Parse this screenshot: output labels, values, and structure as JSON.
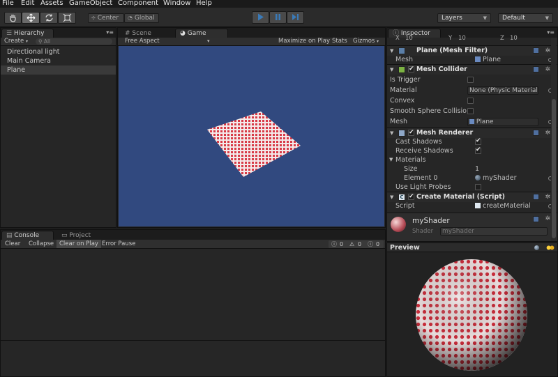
{
  "menu": [
    "File",
    "Edit",
    "Assets",
    "GameObject",
    "Component",
    "Window",
    "Help"
  ],
  "toolbar": {
    "pivot_label": "Center",
    "space_label": "Global",
    "layers_label": "Layers",
    "layout_label": "Default",
    "accent": "#3a7ab8"
  },
  "hierarchy": {
    "tab": "Hierarchy",
    "create_label": "Create",
    "search_placeholder": "All",
    "items": [
      {
        "label": "Directional light"
      },
      {
        "label": "Main Camera"
      },
      {
        "label": "Plane",
        "selected": true
      }
    ]
  },
  "scene": {
    "scene_tab": "Scene",
    "game_tab": "Game",
    "aspect_label": "Free Aspect",
    "maximize_label": "Maximize on Play",
    "stats_label": "Stats",
    "gizmos_label": "Gizmos",
    "background": "#31497f"
  },
  "console": {
    "console_tab": "Console",
    "project_tab": "Project",
    "buttons": [
      "Clear",
      "Collapse",
      "Clear on Play",
      "Error Pause"
    ],
    "counts": [
      "0",
      "0",
      "0"
    ]
  },
  "inspector": {
    "tab": "Inspector",
    "transform_row": [
      "X",
      "10",
      "Y",
      "10",
      "Z",
      "10"
    ],
    "mesh_filter": {
      "title": "Plane (Mesh Filter)",
      "mesh_label": "Mesh",
      "mesh_value": "Plane"
    },
    "mesh_collider": {
      "title": "Mesh Collider",
      "rows": [
        {
          "label": "Is Trigger",
          "value": ""
        },
        {
          "label": "Material",
          "value": "None (Physic Material"
        },
        {
          "label": "Convex",
          "value": ""
        },
        {
          "label": "Smooth Sphere Collisio",
          "value": ""
        },
        {
          "label": "Mesh",
          "value": "Plane"
        }
      ]
    },
    "mesh_renderer": {
      "title": "Mesh Renderer",
      "cast_shadows_label": "Cast Shadows",
      "receive_shadows_label": "Receive Shadows",
      "materials_label": "Materials",
      "size_label": "Size",
      "size_value": "1",
      "element_label": "Element 0",
      "element_value": "myShader",
      "light_probes_label": "Use Light Probes"
    },
    "script": {
      "title": "Create Material (Script)",
      "script_label": "Script",
      "script_value": "createMaterial"
    },
    "material": {
      "name": "myShader",
      "shader_label": "Shader",
      "shader_value": "myShader"
    },
    "preview_label": "Preview"
  }
}
